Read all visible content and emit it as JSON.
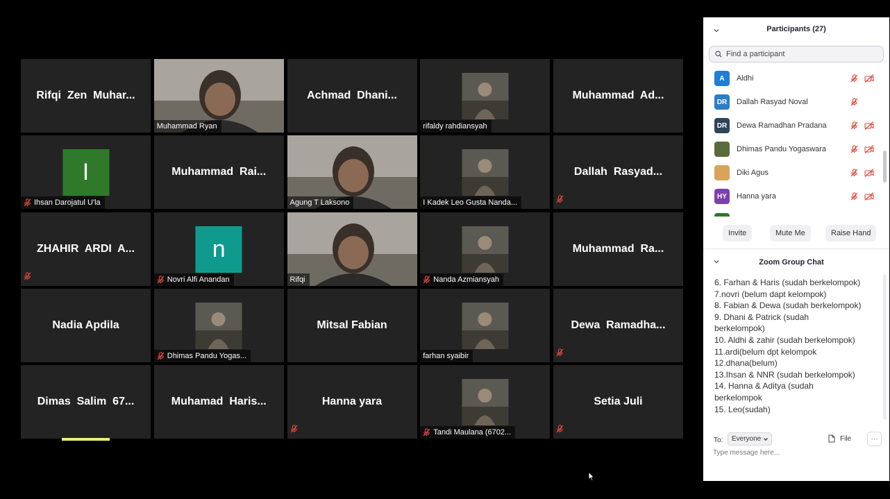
{
  "gallery": {
    "tiles": [
      {
        "name": "Rifqi  Zen  Muhar...",
        "kind": "name"
      },
      {
        "name": "Muhammad Ryan",
        "kind": "video",
        "muted": false
      },
      {
        "name": "Achmad  Dhani...",
        "kind": "name"
      },
      {
        "name": "rifaldy rahdiansyah",
        "kind": "photo",
        "muted": false
      },
      {
        "name": "Muhammad  Ad...",
        "kind": "name"
      },
      {
        "name": "Ihsan Darojatul U'la",
        "kind": "initial",
        "initial": "I",
        "color": "#2f7a2a",
        "muted": true
      },
      {
        "name": "Muhammad  Rai...",
        "kind": "name"
      },
      {
        "name": "Agung T Laksono",
        "kind": "video",
        "muted": false,
        "active": true
      },
      {
        "name": "I Kadek Leo Gusta Nanda...",
        "kind": "photo",
        "muted": false
      },
      {
        "name": "Dallah  Rasyad...",
        "kind": "name",
        "mute_icon": true
      },
      {
        "name": "ZHAHIR  ARDI  A...",
        "kind": "name",
        "mute_icon": true
      },
      {
        "name": "Novri Alfi Anandan",
        "kind": "initial",
        "initial": "n",
        "color": "#0f9a8e",
        "muted": true
      },
      {
        "name": "Rifqi",
        "kind": "video",
        "muted": false
      },
      {
        "name": "Nanda Azmiansyah",
        "kind": "photo",
        "muted": true
      },
      {
        "name": "Muhammad  Ra...",
        "kind": "name"
      },
      {
        "name": "Nadia Apdila",
        "kind": "name"
      },
      {
        "name": "Dhimas Pandu Yogas...",
        "kind": "photo",
        "muted": true
      },
      {
        "name": "Mitsal Fabian",
        "kind": "name"
      },
      {
        "name": "farhan syaibir",
        "kind": "photo",
        "muted": false
      },
      {
        "name": "Dewa  Ramadha...",
        "kind": "name",
        "mute_icon": true
      },
      {
        "name": "Dimas  Salim  67...",
        "kind": "name"
      },
      {
        "name": "Muhamad  Haris...",
        "kind": "name"
      },
      {
        "name": "Hanna yara",
        "kind": "name",
        "mute_icon": true
      },
      {
        "name": "Tandi Maulana (6702...",
        "kind": "photo",
        "muted": true
      },
      {
        "name": "Setia Juli",
        "kind": "name",
        "mute_icon": true
      }
    ]
  },
  "panel": {
    "participants_title": "Participants (27)",
    "search_placeholder": "Find a participant",
    "participants": [
      {
        "initials": "A",
        "name": "Aldhi",
        "color": "#1f7ed6",
        "mic_muted": true,
        "cam_off": true
      },
      {
        "initials": "DR",
        "name": "Dallah Rasyad Noval",
        "color": "#2a7ec6",
        "mic_muted": true,
        "cam_off": false
      },
      {
        "initials": "DR",
        "name": "Dewa Ramadhan Pradana",
        "color": "#2d4459",
        "mic_muted": true,
        "cam_off": true
      },
      {
        "initials": "",
        "name": "Dhimas Pandu Yogaswara",
        "color": "#5a6b3a",
        "mic_muted": true,
        "cam_off": true
      },
      {
        "initials": "",
        "name": "Diki Agus",
        "color": "#d9a35a",
        "mic_muted": true,
        "cam_off": true
      },
      {
        "initials": "HY",
        "name": "Hanna yara",
        "color": "#7b3fb0",
        "mic_muted": true,
        "cam_off": true
      }
    ],
    "buttons": {
      "invite": "Invite",
      "mute_me": "Mute Me",
      "raise_hand": "Raise Hand"
    },
    "chat_title": "Zoom Group Chat",
    "chat_lines": [
      "6. Farhan & Haris (sudah berkelompok)",
      "7.novri (belum dapt kelompok)",
      "8. Fabian & Dewa (sudah berkelompok)",
      "9. Dhani & Patrick (sudah",
      "berkelompok)",
      "10. Aldhi & zahir (sudah berkelompok)",
      "11.ardi(belum dpt kelompok",
      "12.dhana(belum)",
      "13.Ihsan & NNR (sudah berkelompok)",
      "14. Hanna & Aditya (sudah",
      "berkelompok",
      "15. Leo(sudah)"
    ],
    "to_label": "To:",
    "to_value": "Everyone",
    "file_label": "File",
    "message_placeholder": "Type message here..."
  }
}
